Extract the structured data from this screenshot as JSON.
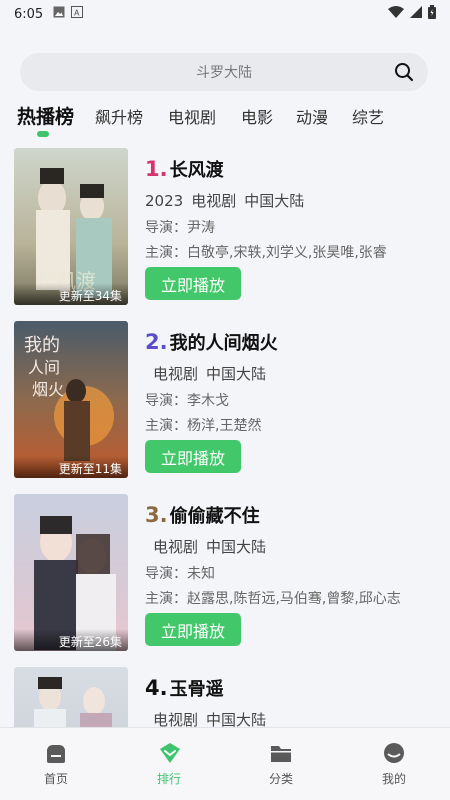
{
  "status_bar": {
    "time": "6:05"
  },
  "search": {
    "placeholder": "斗罗大陆"
  },
  "tabs": [
    {
      "label": "热播榜",
      "active": true
    },
    {
      "label": "飙升榜"
    },
    {
      "label": "电视剧"
    },
    {
      "label": "电影"
    },
    {
      "label": "动漫"
    },
    {
      "label": "综艺"
    }
  ],
  "items": [
    {
      "rank": "1.",
      "rank_color": "#d6336c",
      "title": "长风渡",
      "year": "2023",
      "type": "电视剧",
      "region": "中国大陆",
      "director": "导演：尹涛",
      "cast": "主演：白敬亭,宋轶,刘学义,张昊唯,张睿",
      "badge": "更新至34集",
      "play_label": "立即播放"
    },
    {
      "rank": "2.",
      "rank_color": "#5b4fc9",
      "title": "我的人间烟火",
      "year": "",
      "type": "电视剧",
      "region": "中国大陆",
      "director": "导演：李木戈",
      "cast": "主演：杨洋,王楚然",
      "badge": "更新至11集",
      "play_label": "立即播放"
    },
    {
      "rank": "3.",
      "rank_color": "#8a6a3f",
      "title": "偷偷藏不住",
      "year": "",
      "type": "电视剧",
      "region": "中国大陆",
      "director": "导演：未知",
      "cast": "主演：赵露思,陈哲远,马伯骞,曾黎,邱心志",
      "badge": "更新至26集",
      "play_label": "立即播放"
    },
    {
      "rank": "4.",
      "rank_color": "#111111",
      "title": "玉骨遥",
      "year": "",
      "type": "电视剧",
      "region": "中国大陆",
      "director": "",
      "cast": "",
      "badge": "",
      "play_label": ""
    }
  ],
  "bottom_nav": [
    {
      "label": "首页",
      "icon": "home-icon"
    },
    {
      "label": "排行",
      "icon": "ranking-icon",
      "active": true
    },
    {
      "label": "分类",
      "icon": "folder-icon"
    },
    {
      "label": "我的",
      "icon": "profile-icon"
    }
  ],
  "colors": {
    "accent": "#42c86a",
    "background": "#f4f5f9"
  }
}
